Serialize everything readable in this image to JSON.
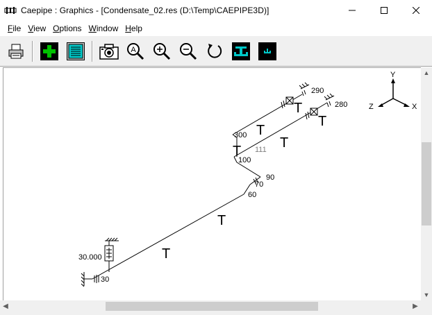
{
  "window": {
    "title": "Caepipe : Graphics -  [Condensate_02.res (D:\\Temp\\CAEPIPE3D)]",
    "minimize_glyph": "—",
    "maximize_glyph": "☐",
    "close_glyph": "✕"
  },
  "menu": {
    "items": [
      {
        "accel": "F",
        "rest": "ile"
      },
      {
        "accel": "V",
        "rest": "iew"
      },
      {
        "accel": "O",
        "rest": "ptions"
      },
      {
        "accel": "W",
        "rest": "indow"
      },
      {
        "accel": "H",
        "rest": "elp"
      }
    ]
  },
  "toolbar": {
    "icons": [
      "printer-icon",
      "add-icon",
      "list-icon",
      "camera-icon",
      "zoom-auto-icon",
      "zoom-in-icon",
      "zoom-out-icon",
      "rotate-icon",
      "support-view-icon",
      "support-small-icon"
    ],
    "zoom_auto_letter": "A"
  },
  "graphics": {
    "axes": {
      "y": "Y",
      "z": "Z",
      "x": "X"
    },
    "node_labels": {
      "n290": "290",
      "n280": "280",
      "n300": "300",
      "n111": "111",
      "n100": "100",
      "n90": "90",
      "n70": "70",
      "n60": "60",
      "n30": "30",
      "spring_value": "30.000"
    },
    "support_glyph": "T",
    "colors": {
      "pipe": "#000000",
      "node_gray": "#808080",
      "toolbar_dark": "#000000",
      "toolbar_green": "#00c000",
      "toolbar_teal": "#00c8c8",
      "axis": "#000000"
    }
  }
}
